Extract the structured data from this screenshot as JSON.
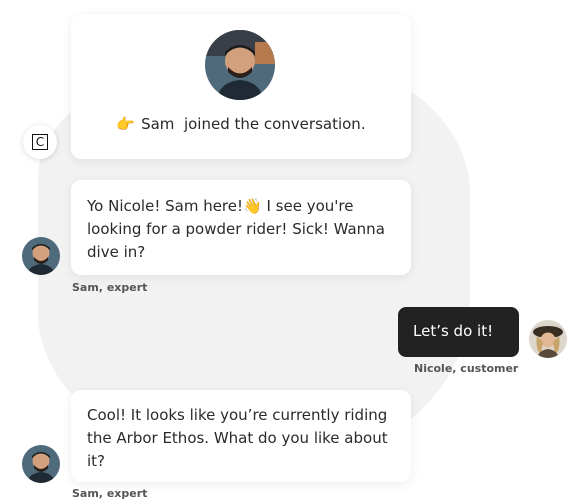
{
  "join": {
    "name": "Sam",
    "message": "joined the conversation."
  },
  "messages": [
    {
      "text": "Yo Nicole! Sam here!👋 I see you're looking for a powder rider! Sick! Wanna dive in?",
      "sender": "Sam, expert"
    },
    {
      "text": "Let’s do it!",
      "sender": "Nicole, customer"
    },
    {
      "text": "Cool! It looks like you’re currently riding the Arbor Ethos. What do you like about it?",
      "sender": "Sam, expert"
    }
  ],
  "brand": {
    "mark": "C"
  },
  "colors": {
    "background": "#ffffff",
    "blob": "#f2f2f2",
    "customer_bubble": "#222222",
    "text": "#2a2a2a"
  }
}
